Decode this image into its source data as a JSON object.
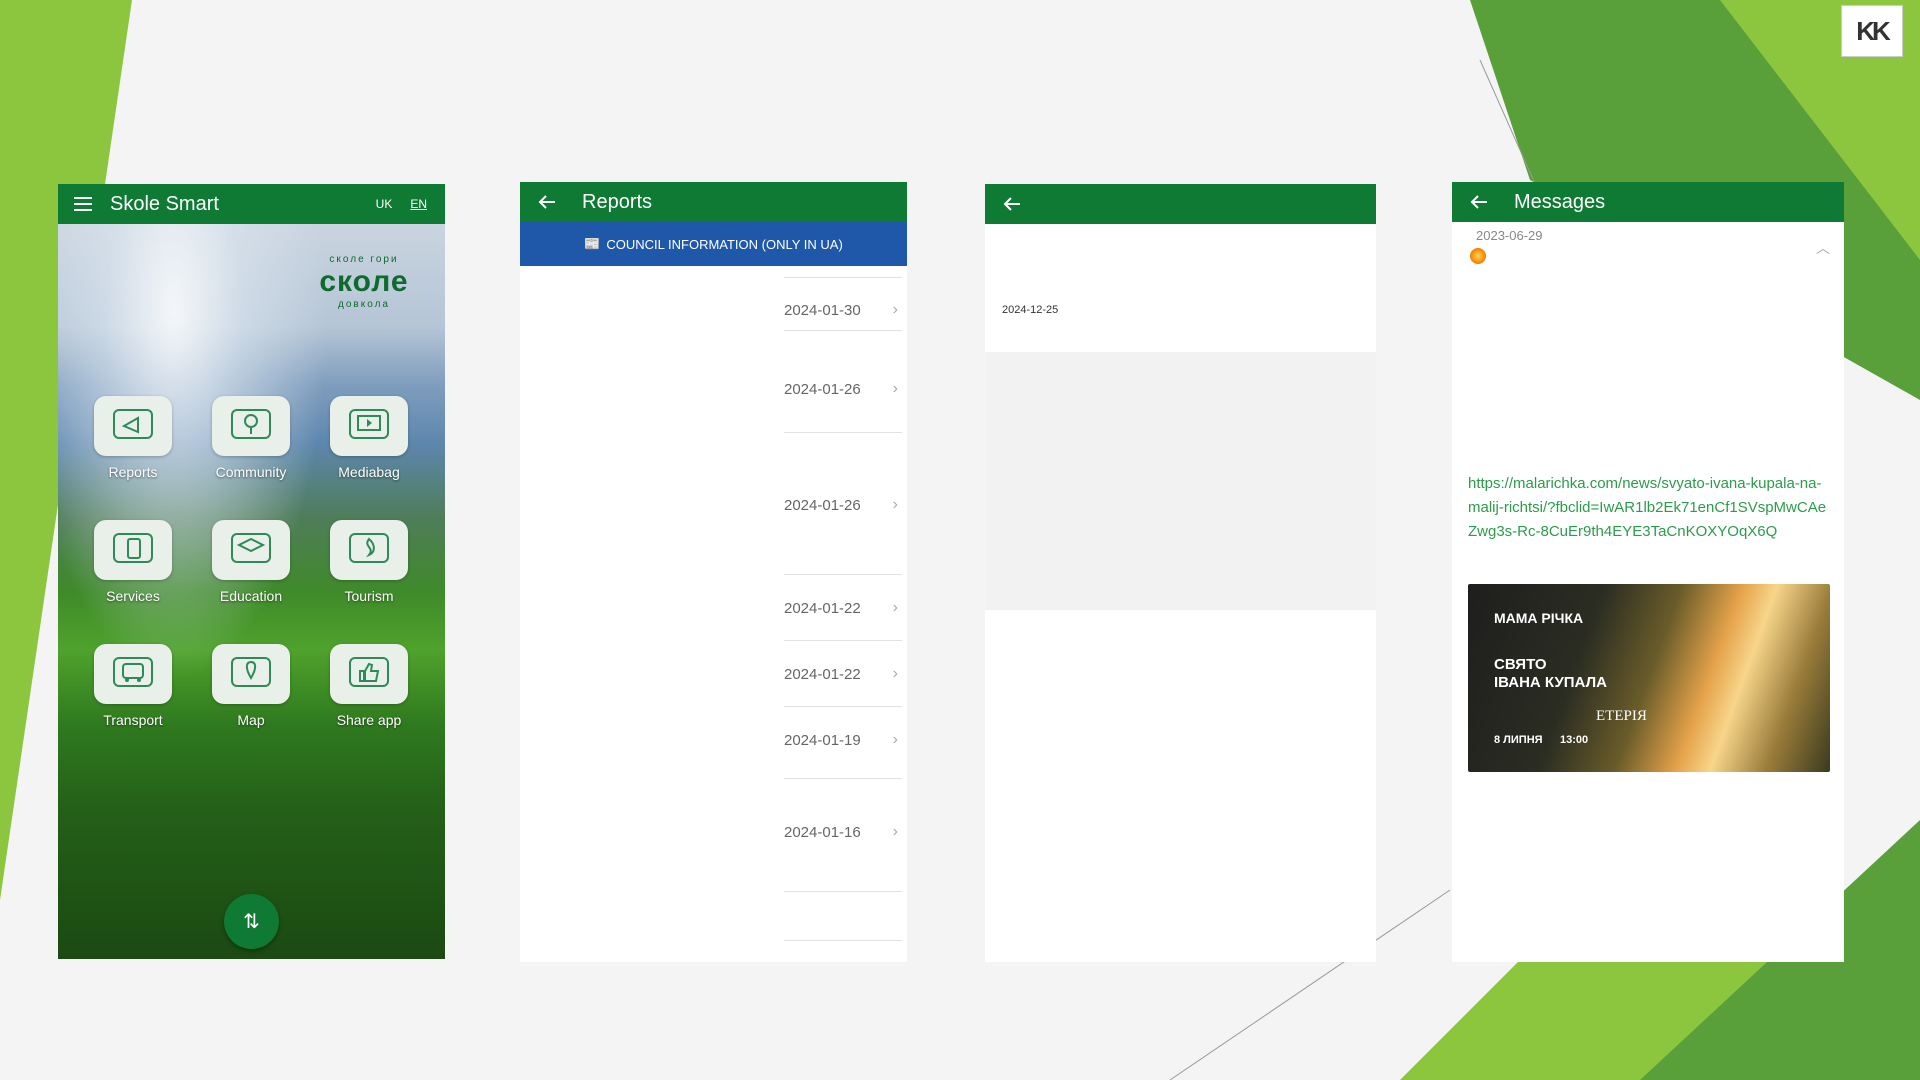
{
  "screen_home": {
    "app_title": "Skole Smart",
    "lang_options": [
      "UK",
      "EN"
    ],
    "active_lang": "EN",
    "logo_text": "сколе",
    "logo_ring_top": "сколе гори",
    "logo_ring_bottom": "довкола",
    "tiles": [
      {
        "label": "Reports",
        "icon": "megaphone-icon"
      },
      {
        "label": "Community",
        "icon": "community-tree-icon"
      },
      {
        "label": "Mediabag",
        "icon": "media-folder-icon"
      },
      {
        "label": "Services",
        "icon": "phone-services-icon"
      },
      {
        "label": "Education",
        "icon": "graduation-cap-icon"
      },
      {
        "label": "Tourism",
        "icon": "campfire-icon"
      },
      {
        "label": "Transport",
        "icon": "bus-icon"
      },
      {
        "label": "Map",
        "icon": "map-pin-icon"
      },
      {
        "label": "Share app",
        "icon": "thumbs-up-icon"
      }
    ],
    "fab_icon": "swap-vertical-icon"
  },
  "screen_reports": {
    "title": "Reports",
    "council_label": "COUNCIL INFORMATION (ONLY IN UA)",
    "dates": [
      "2024-01-30",
      "2024-01-26",
      "2024-01-26",
      "2024-01-22",
      "2024-01-22",
      "2024-01-19",
      "2024-01-16"
    ]
  },
  "screen_detail": {
    "date": "2024-12-25"
  },
  "screen_messages": {
    "title": "Messages",
    "date": "2023-06-29",
    "link": "https://malarichka.com/news/svyato-ivana-kupala-na-malij-richtsi/?fbclid=IwAR1lb2Ek71enCf1SVspMwCAeZwg3s-Rc-8CuEr9th4EYE3TaCnKOXYOqX6Q",
    "poster": {
      "brand": "МАМА РІЧКА",
      "title_line1": "СВЯТО",
      "title_line2": "ІВАНА КУПАЛА",
      "brand2": "ЕТЕРІЯ",
      "date": "8 ЛИПНЯ",
      "time": "13:00"
    }
  },
  "corner_logo": "KK",
  "colors": {
    "appbar": "#0e7a34",
    "council": "#1f58a8",
    "link": "#2a9d4a"
  }
}
